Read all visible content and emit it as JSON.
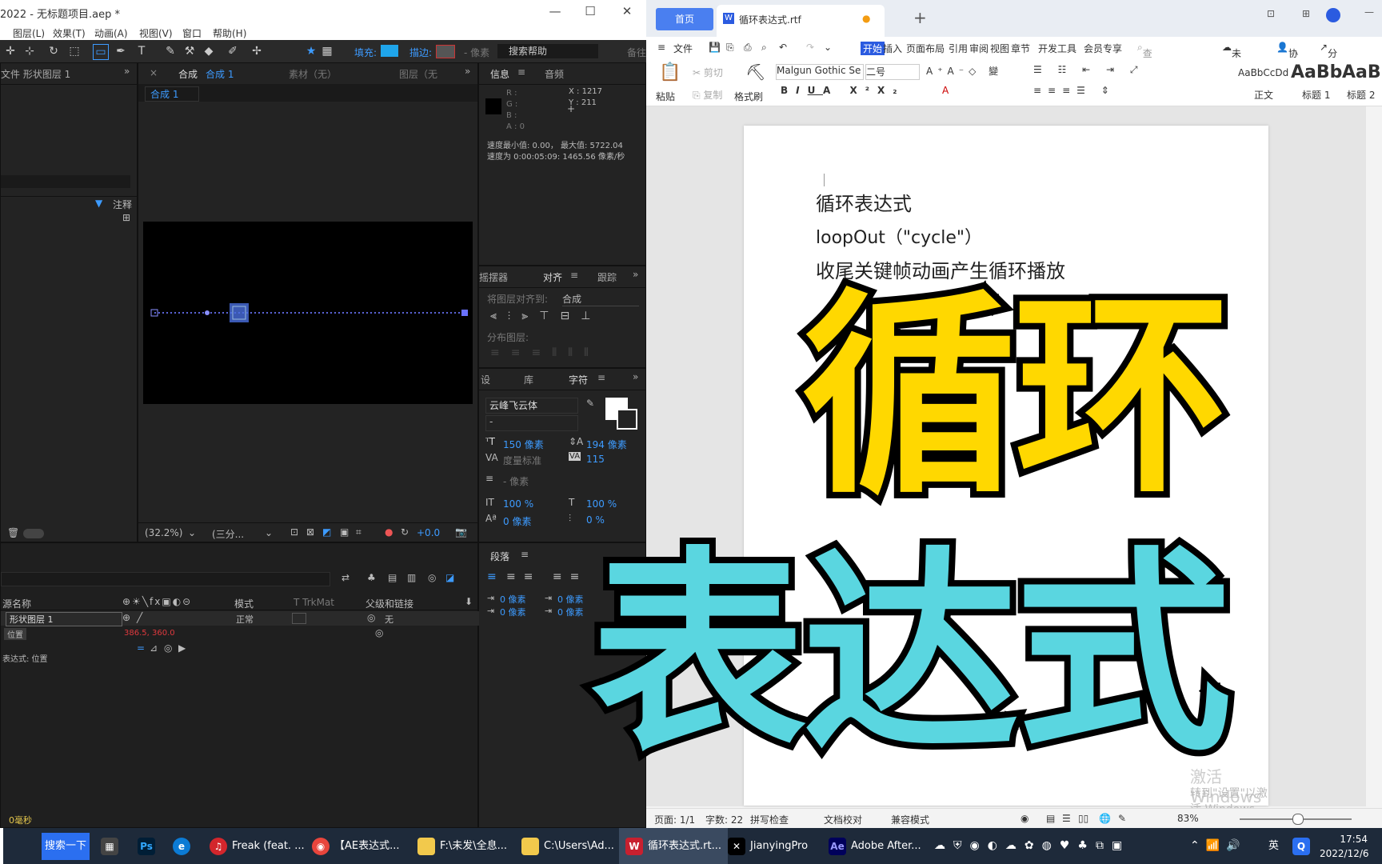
{
  "ae": {
    "title": "2022 - 无标题项目.aep *",
    "menu": [
      "图层(L)",
      "效果(T)",
      "动画(A)",
      "视图(V)",
      "窗口",
      "帮助(H)"
    ],
    "toolbar": {
      "fill_label": "填充:",
      "stroke_label": "描边:",
      "pixel_label": "- 像素",
      "search_placeholder": "搜索帮助",
      "extra": "备往"
    },
    "project_panel": {
      "title": "文件 形状图层 1",
      "notes_label": "注释"
    },
    "comp_panel": {
      "tab_label": "合成",
      "comp_name": "合成 1",
      "breadcrumb": "合成 1",
      "footage_label": "素材（无）",
      "layer_label": "图层（无",
      "zoom": "(32.2%)",
      "resolution": "(三分...",
      "exposure": "+0.0"
    },
    "info_panel": {
      "tab_info": "信息",
      "tab_audio": "音频",
      "r": "R :",
      "g": "G :",
      "b": "B :",
      "a": "A : 0",
      "x": "X : 1217",
      "y": "Y : 211",
      "speed_line1": "速度最小值: 0.00， 最大值: 5722.04",
      "speed_line2": "速度为 0:00:05:09: 1465.56 像素/秒"
    },
    "align_panel": {
      "tab_wiggler": "摇摆器",
      "tab_align": "对齐",
      "tab_track": "跟踪",
      "align_to_label": "将图层对齐到:",
      "align_to_value": "合成",
      "distribute_label": "分布图层:"
    },
    "char_panel": {
      "tab_presets": "设",
      "tab_library": "库",
      "tab_char": "字符",
      "font": "云峰飞云体",
      "style": "-",
      "size": "150 像素",
      "leading": "194 像素",
      "kerning": "度量标准",
      "tracking": "115",
      "stroke_width": "- 像素",
      "vscale": "100 %",
      "hscale": "100 %",
      "baseline": "0 像素",
      "tsume": "0 %"
    },
    "para_panel": {
      "title": "段落",
      "indent1": "0 像素",
      "indent2": "0 像素",
      "indent3": "0 像素",
      "indent4": "0 像素"
    },
    "timeline": {
      "col_name": "源名称",
      "col_mode": "模式",
      "col_trkmat": "T  TrkMat",
      "col_parent": "父级和链接",
      "layer_name": "形状图层 1",
      "layer_mode": "正常",
      "layer_parent": "无",
      "prop_name": "位置",
      "prop_value": "386.5, 360.0",
      "expr_label": "表达式: 位置",
      "footer": "0毫秒"
    }
  },
  "wps": {
    "home_tab": "首页",
    "doc_tab": "循环表达式.rtf",
    "menu": [
      "文件",
      "开始",
      "插入",
      "页面布局",
      "引用",
      "审阅",
      "视图",
      "章节",
      "开发工具",
      "会员专享"
    ],
    "search_placeholder": "查找命...",
    "sync": "未同步",
    "collab": "协作",
    "share": "分享",
    "ribbon": {
      "paste": "粘贴",
      "cut": "剪切",
      "copy": "复制",
      "format_painter": "格式刷",
      "font": "Malgun Gothic Se",
      "size": "二号",
      "style_normal": "正文",
      "style_h1": "标题 1",
      "style_h2": "标题 2",
      "style_sample": "AaBbCcDd",
      "style_h_sample": "AaBb"
    },
    "doc": {
      "line1": "循环表达式",
      "line2": "loopOut（\"cycle\"）",
      "line3": "收尾关键帧动画产生循环播放"
    },
    "watermark1": "激活 Windows",
    "watermark2": "转到\"设置\"以激活 Windows。",
    "status": {
      "page": "页面: 1/1",
      "words": "字数: 22",
      "spell": "拼写检查",
      "proof": "文档校对",
      "compat": "兼容模式",
      "zoom": "83%"
    }
  },
  "overlay": {
    "line1": "循环",
    "line2": "表达式",
    "color1": "#ffd800",
    "color2": "#5ad6e0"
  },
  "taskbar": {
    "search": "搜索一下",
    "items": [
      "Freak (feat. ...",
      "【AE表达式...",
      "F:\\未发\\全息...",
      "C:\\Users\\Ad...",
      "循环表达式.rt...",
      "JianyingPro",
      "Adobe After..."
    ],
    "ime": "英",
    "time": "17:54",
    "date": "2022/12/6"
  }
}
